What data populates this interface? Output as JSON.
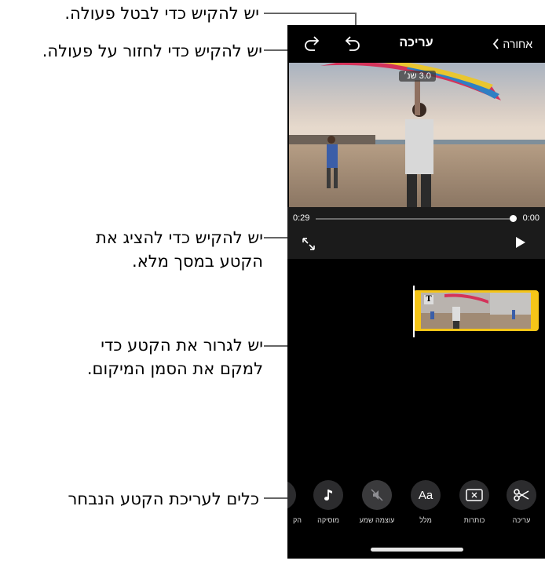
{
  "callouts": {
    "undo": "יש להקיש כדי לבטל פעולה.",
    "redo": "יש להקיש כדי לחזור על פעולה.",
    "fullscreen_line1": "יש להקיש כדי להציג את",
    "fullscreen_line2": "הקטע במסך מלא.",
    "drag_line1": "יש לגרור את הקטע כדי",
    "drag_line2": "למקם את הסמן המיקום.",
    "tools": "כלים לעריכת הקטע הנבחר"
  },
  "nav": {
    "title": "עריכה",
    "back_label": "אחורה",
    "back_icon": "chevron-left-icon",
    "undo_icon": "undo-arrow-icon",
    "redo_icon": "redo-arrow-icon"
  },
  "viewer": {
    "duration_badge": "3.0 שנ׳"
  },
  "playback": {
    "time_left": "0:29",
    "time_right": "0:00",
    "progress": 1.0
  },
  "toolbar": {
    "items": [
      {
        "label": "עריכה",
        "icon": "scissors-icon"
      },
      {
        "label": "כותרות",
        "icon": "titles-icon"
      },
      {
        "label": "מלל",
        "icon": "text-icon",
        "glyph": "Aa"
      },
      {
        "label": "עוצמה שמע",
        "icon": "volume-muted-icon"
      },
      {
        "label": "מוסיקה",
        "icon": "music-note-icon"
      },
      {
        "label": "הק",
        "icon": "partial-tool-icon"
      }
    ]
  },
  "colors": {
    "clip_border": "#f5c518",
    "screen_bg": "#000000",
    "tool_circle": "#2c2c2e"
  }
}
